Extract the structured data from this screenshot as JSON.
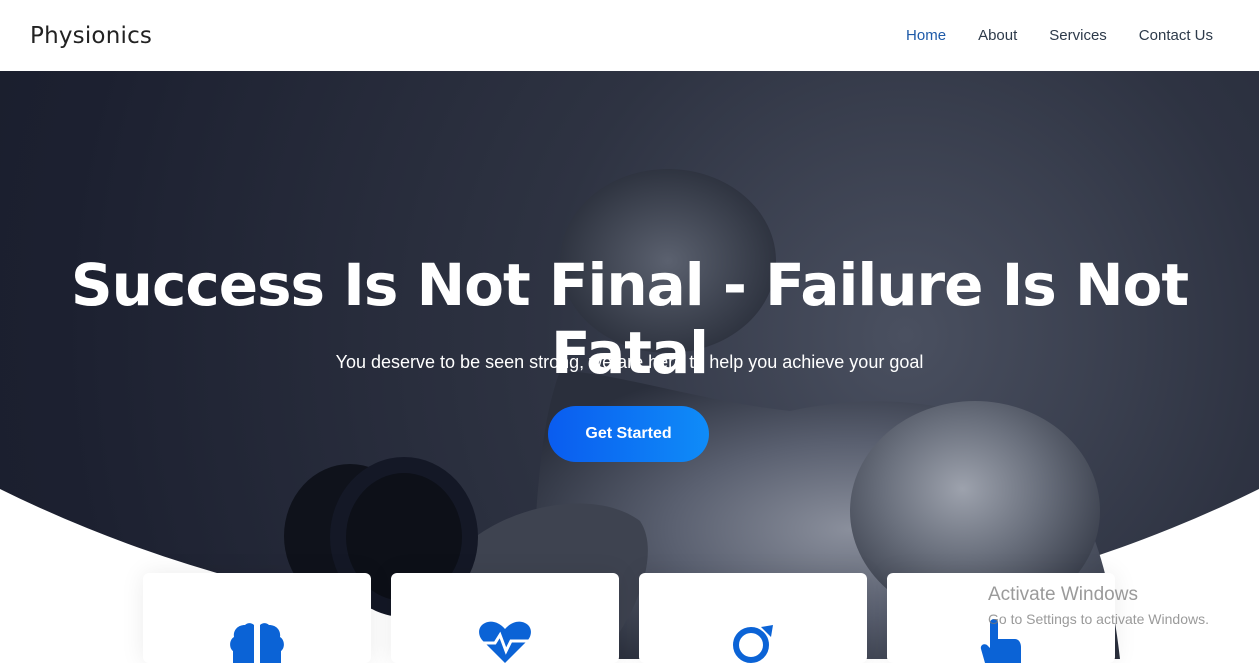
{
  "brand": "Physionics",
  "nav": {
    "items": [
      {
        "label": "Home",
        "active": true
      },
      {
        "label": "About",
        "active": false
      },
      {
        "label": "Services",
        "active": false
      },
      {
        "label": "Contact Us",
        "active": false
      }
    ]
  },
  "hero": {
    "title": "Success Is Not Final - Failure Is Not Fatal",
    "subtitle": "You deserve to be seen strong, we are here to help you achieve your goal",
    "cta_label": "Get Started"
  },
  "cards": [
    {
      "icon": "brain-icon"
    },
    {
      "icon": "heart-pulse-icon"
    },
    {
      "icon": "ring-icon"
    },
    {
      "icon": "hand-pointer-icon"
    }
  ],
  "watermark": {
    "title": "Activate Windows",
    "subtitle": "Go to Settings to activate Windows."
  },
  "colors": {
    "accent": "#1e5aa8",
    "button_start": "#0a5cef",
    "button_end": "#0f8cf8",
    "icon": "#0b63d6",
    "hero_dark": "#151926"
  }
}
